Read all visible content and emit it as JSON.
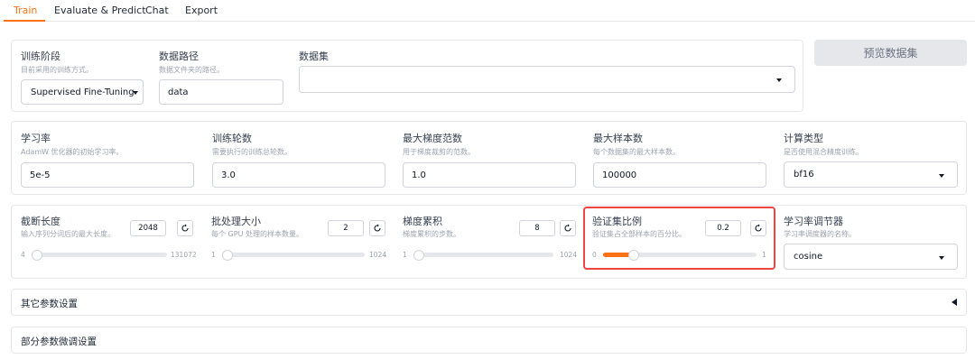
{
  "tabs": [
    {
      "label": "Train",
      "active": true
    },
    {
      "label": "Evaluate & Predict",
      "active": false
    },
    {
      "label": "Chat",
      "active": false
    },
    {
      "label": "Export",
      "active": false
    }
  ],
  "row1": {
    "stage": {
      "label": "训练阶段",
      "desc": "目前采用的训练方式。",
      "value": "Supervised Fine-Tuning"
    },
    "data_path": {
      "label": "数据路径",
      "desc": "数据文件夹的路径。",
      "value": "data"
    },
    "dataset": {
      "label": "数据集",
      "value": ""
    },
    "preview_button": "预览数据集"
  },
  "row2": {
    "learning_rate": {
      "label": "学习率",
      "desc": "AdamW 优化器的初始学习率。",
      "value": "5e-5"
    },
    "epochs": {
      "label": "训练轮数",
      "desc": "需要执行的训练总轮数。",
      "value": "3.0"
    },
    "max_grad_norm": {
      "label": "最大梯度范数",
      "desc": "用于梯度裁剪的范数。",
      "value": "1.0"
    },
    "max_samples": {
      "label": "最大样本数",
      "desc": "每个数据集的最大样本数。",
      "value": "100000"
    },
    "compute_type": {
      "label": "计算类型",
      "desc": "是否使用混合精度训练。",
      "value": "bf16"
    }
  },
  "row3": {
    "cutoff_len": {
      "label": "截断长度",
      "desc": "输入序列分词后的最大长度。",
      "value": "2048",
      "min": "4",
      "max": "131072",
      "fraction": 0.015
    },
    "batch_size": {
      "label": "批处理大小",
      "desc": "每个 GPU 处理的样本数量。",
      "value": "2",
      "min": "1",
      "max": "1024",
      "fraction": 0.001
    },
    "grad_accum": {
      "label": "梯度累积",
      "desc": "梯度累积的步数。",
      "value": "8",
      "min": "1",
      "max": "1024",
      "fraction": 0.007
    },
    "val_size": {
      "label": "验证集比例",
      "desc": "验证集占全部样本的百分比。",
      "value": "0.2",
      "min": "0",
      "max": "1",
      "fraction": 0.2
    },
    "lr_scheduler": {
      "label": "学习率调节器",
      "desc": "学习率调度器的名称。",
      "value": "cosine"
    }
  },
  "accordions": [
    {
      "label": "其它参数设置"
    },
    {
      "label": "部分参数微调设置"
    }
  ],
  "colors": {
    "accent": "#f97316",
    "highlight": "#ef4444"
  }
}
